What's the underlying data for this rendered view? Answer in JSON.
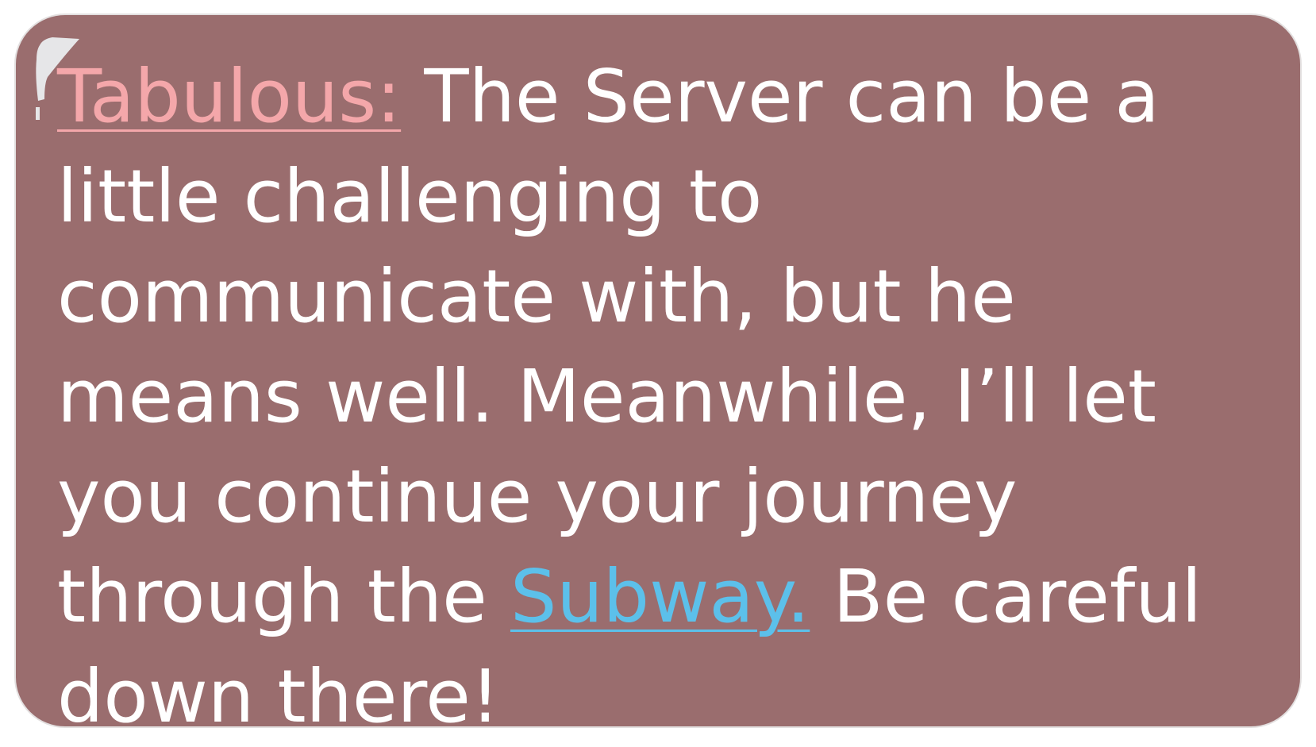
{
  "dialog": {
    "speaker": "Tabulous:",
    "line_part1": " The Server can be a little challenging to communicate with, but he means well. Meanwhile, I’ll let you continue your journey through the ",
    "keyword": "Subway.",
    "line_part2": " Be careful down there!"
  },
  "colors": {
    "box_background": "#9a6d6e",
    "text": "#ffffff",
    "speaker": "#f4a7aa",
    "keyword": "#5cc0ea",
    "corner_tab": "#e6e6e8"
  }
}
